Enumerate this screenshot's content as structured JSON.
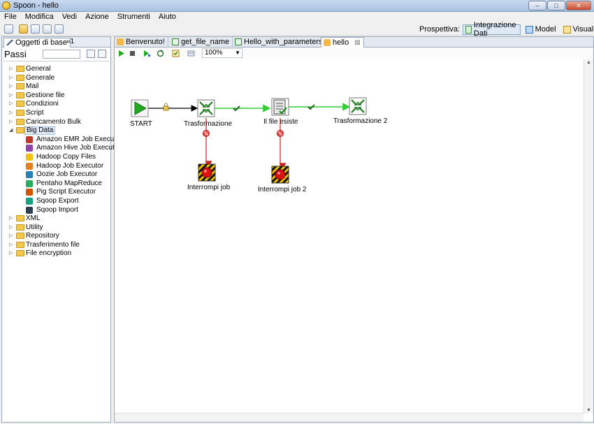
{
  "window": {
    "title": "Spoon - hello",
    "minimize": "–",
    "maximize": "□",
    "close": "✕"
  },
  "menu": [
    "File",
    "Modifica",
    "Vedi",
    "Azione",
    "Strumenti",
    "Aiuto"
  ],
  "perspective": {
    "label": "Prospettiva:",
    "buttons": [
      "Integrazione Dati",
      "Model",
      "Visualize"
    ]
  },
  "left_panel": {
    "tab": "Oggetti di base",
    "tab_more": "»1",
    "header": "Passi",
    "search_placeholder": "",
    "tree": [
      {
        "label": "General"
      },
      {
        "label": "Generale"
      },
      {
        "label": "Mail"
      },
      {
        "label": "Gestione file"
      },
      {
        "label": "Condizioni"
      },
      {
        "label": "Script"
      },
      {
        "label": "Caricamento Bulk"
      },
      {
        "label": "Big Data",
        "expanded": true,
        "selected": true
      },
      {
        "label": "Amazon EMR Job Executor",
        "child": true
      },
      {
        "label": "Amazon Hive Job Executor",
        "child": true
      },
      {
        "label": "Hadoop Copy Files",
        "child": true
      },
      {
        "label": "Hadoop Job Executor",
        "child": true
      },
      {
        "label": "Oozie Job Executor",
        "child": true
      },
      {
        "label": "Pentaho MapReduce",
        "child": true
      },
      {
        "label": "Pig Script Executor",
        "child": true
      },
      {
        "label": "Sqoop Export",
        "child": true
      },
      {
        "label": "Sqoop Import",
        "child": true
      },
      {
        "label": "XML"
      },
      {
        "label": "Utility"
      },
      {
        "label": "Repository"
      },
      {
        "label": "Trasferimento file"
      },
      {
        "label": "File encryption"
      }
    ]
  },
  "tabs": [
    {
      "label": "Benvenuto!",
      "icon": "job-icon"
    },
    {
      "label": "get_file_name",
      "icon": "transformation-icon"
    },
    {
      "label": "Hello_with_parameters",
      "icon": "transformation-icon"
    },
    {
      "label": "hello",
      "icon": "job-icon",
      "active": true,
      "close": "⊠"
    }
  ],
  "editor_toolbar": {
    "zoom": "100%"
  },
  "canvas": {
    "nodes": {
      "start": "START",
      "trasformazione": "Trasformazione",
      "file_esiste": "Il file esiste",
      "trasformazione2": "Trasformazione 2",
      "interrompi": "Interrompi job",
      "interrompi2": "Interrompi job 2"
    }
  },
  "colors": {
    "hop_ok": "#33cc33",
    "hop_fail": "#cc2222",
    "hop_unconditional": "#000000",
    "start_green": "#22aa22"
  }
}
